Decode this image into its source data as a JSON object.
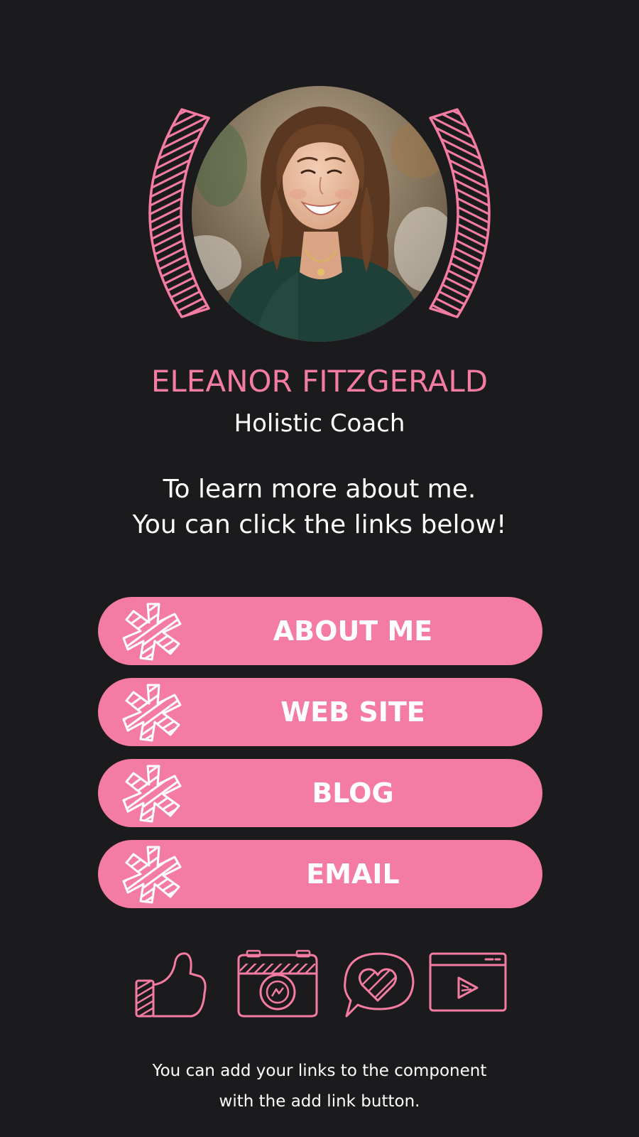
{
  "profile": {
    "name": "ELEANOR FITZGERALD",
    "title": "Holistic Coach"
  },
  "intro": {
    "line1": "To learn more about me.",
    "line2": "You can click the links below!"
  },
  "links": [
    {
      "label": "ABOUT ME"
    },
    {
      "label": "WEB SITE"
    },
    {
      "label": "BLOG"
    },
    {
      "label": "EMAIL"
    }
  ],
  "social_icons": [
    "thumbs-up-icon",
    "camera-icon",
    "chat-heart-icon",
    "video-play-icon"
  ],
  "footer": {
    "line1": "You can add your links to the component",
    "line2": "with the add link button."
  },
  "colors": {
    "background": "#1b1b1d",
    "accent": "#f47ba3",
    "text": "#ffffff"
  }
}
